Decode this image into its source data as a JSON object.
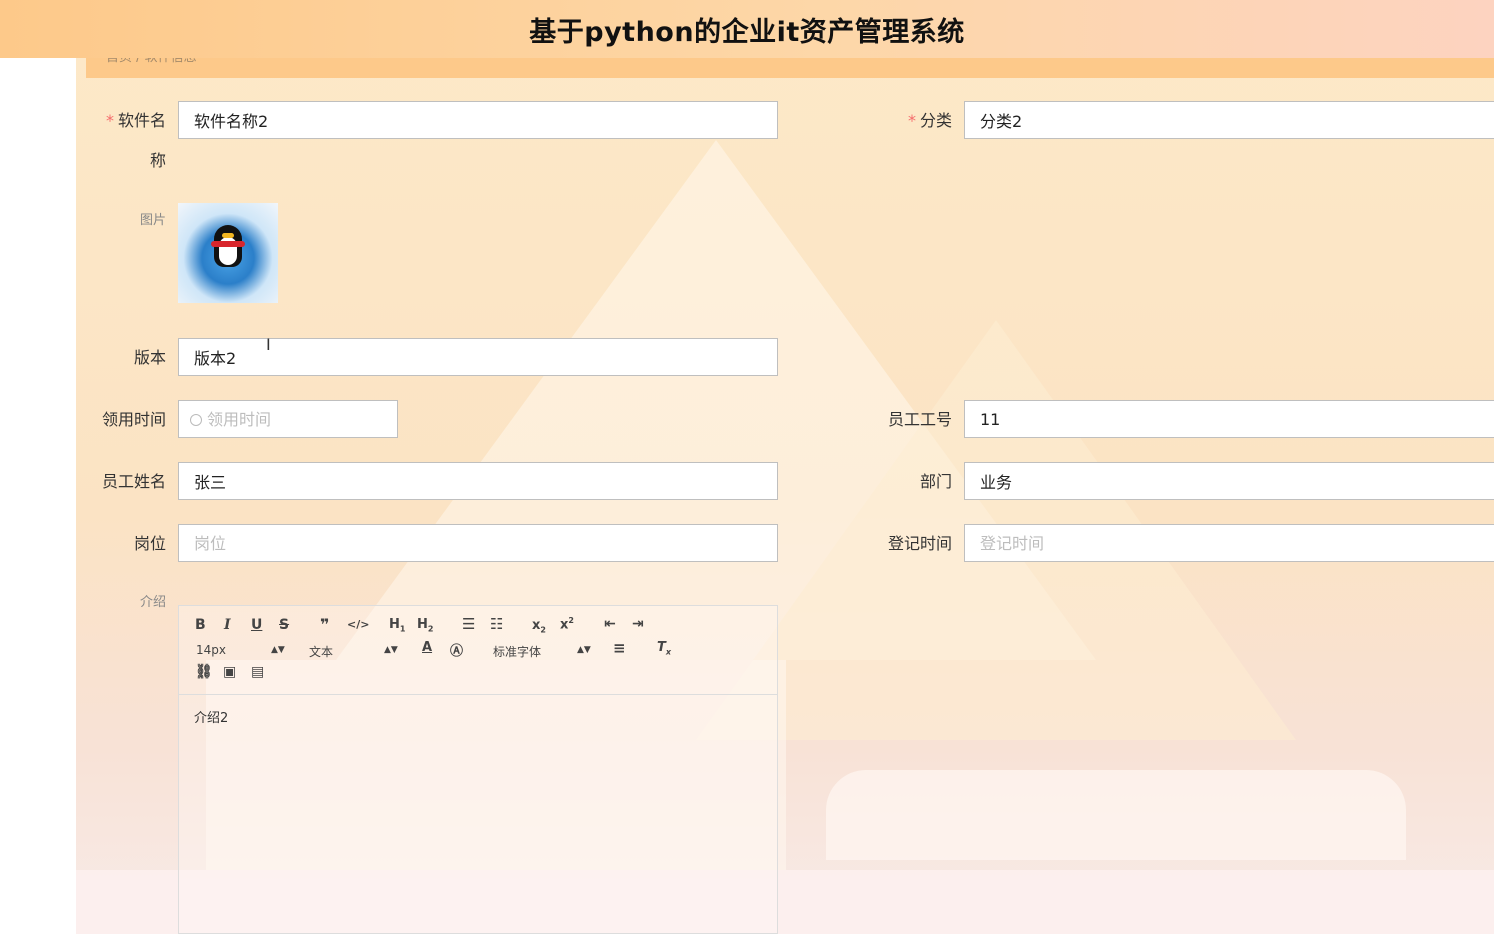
{
  "header": {
    "title": "基于python的企业it资产管理系统"
  },
  "breadcrumb": {
    "text": "首页 / 软件信息"
  },
  "form": {
    "software_name": {
      "label_1": "软件名",
      "label_2": "称",
      "value": "软件名称2"
    },
    "category": {
      "label": "分类",
      "value": "分类2"
    },
    "image": {
      "label": "图片"
    },
    "version": {
      "label": "版本",
      "value": "版本2"
    },
    "receive_time": {
      "label": "领用时间",
      "placeholder": "领用时间"
    },
    "employee_no": {
      "label": "员工工号",
      "value": "11"
    },
    "employee_name": {
      "label": "员工姓名",
      "value": "张三"
    },
    "department": {
      "label": "部门",
      "value": "业务"
    },
    "position": {
      "label": "岗位",
      "placeholder": "岗位"
    },
    "register_time": {
      "label": "登记时间",
      "placeholder": "登记时间"
    },
    "intro": {
      "label": "介绍",
      "font_size": "14px",
      "text_style": "文本",
      "font_family": "标准字体",
      "content": "介绍2"
    }
  },
  "required_mark": "*"
}
